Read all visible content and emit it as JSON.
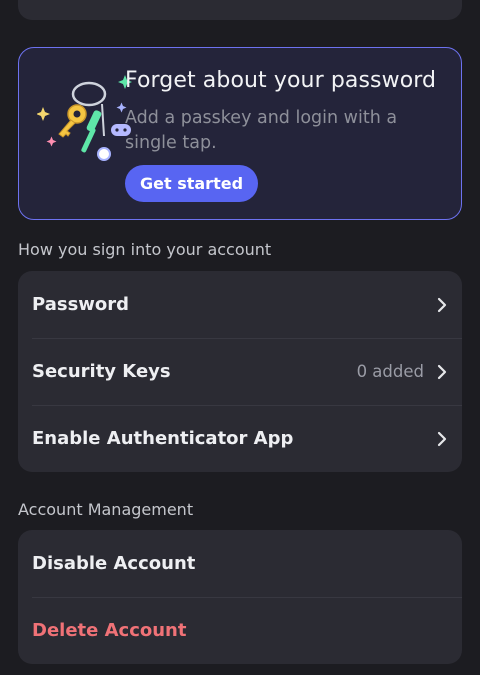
{
  "promo": {
    "title": "Forget about your password",
    "subtitle": "Add a passkey and login with a single tap.",
    "button_label": "Get started",
    "accent_color": "#5865f2"
  },
  "sign_in_section": {
    "title": "How you sign into your account",
    "items": [
      {
        "label": "Password",
        "value": ""
      },
      {
        "label": "Security Keys",
        "value": "0 added"
      },
      {
        "label": "Enable Authenticator App",
        "value": ""
      }
    ]
  },
  "account_section": {
    "title": "Account Management",
    "items": [
      {
        "label": "Disable Account"
      },
      {
        "label": "Delete Account",
        "color": "#f07277"
      }
    ]
  },
  "icons": {
    "row_chevron": "chevron-right-icon",
    "promo_art": "keychain-icon"
  }
}
